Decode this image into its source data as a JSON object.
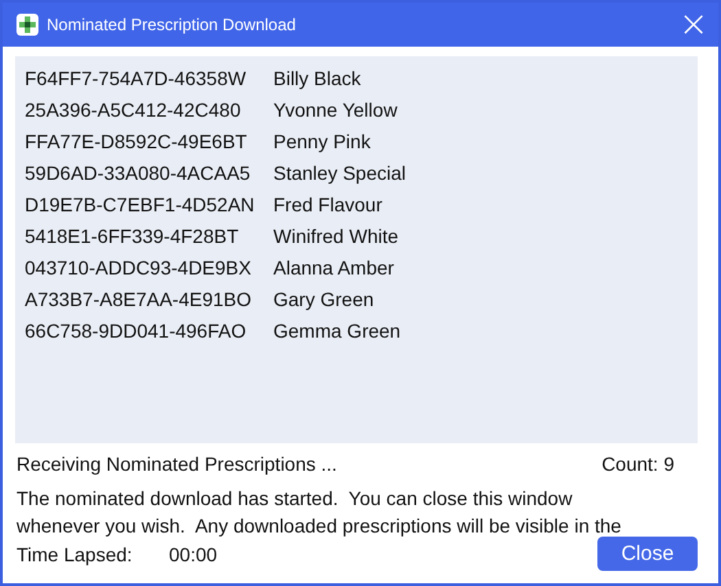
{
  "window": {
    "title": "Nominated Prescription Download",
    "close": "×"
  },
  "prescriptions": [
    {
      "id": "F64FF7-754A7D-46358W",
      "patient": "Billy Black"
    },
    {
      "id": "25A396-A5C412-42C480",
      "patient": "Yvonne Yellow"
    },
    {
      "id": "FFA77E-D8592C-49E6BT",
      "patient": "Penny Pink"
    },
    {
      "id": "59D6AD-33A080-4ACAA5",
      "patient": "Stanley Special"
    },
    {
      "id": "D19E7B-C7EBF1-4D52AN",
      "patient": "Fred Flavour"
    },
    {
      "id": "5418E1-6FF339-4F28BT",
      "patient": "Winifred White"
    },
    {
      "id": "043710-ADDC93-4DE9BX",
      "patient": "Alanna Amber"
    },
    {
      "id": "A733B7-A8E7AA-4E91BO",
      "patient": "Gary Green"
    },
    {
      "id": "66C758-9DD041-496FAO",
      "patient": "Gemma Green"
    }
  ],
  "status": "Receiving Nominated Prescriptions ...",
  "count": "Count: 9",
  "message": "The nominated download has started.  You can close this window whenever you wish.  Any downloaded prescriptions will be visible in the",
  "time_label": "Time Lapsed:",
  "time_value": "00:00",
  "close_button": "Close"
}
